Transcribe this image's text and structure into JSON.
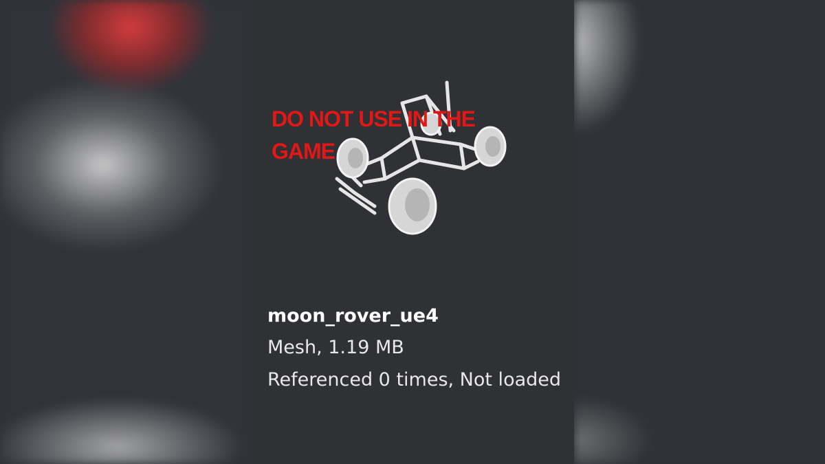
{
  "asset": {
    "name": "moon_rover_ue4",
    "type_size": "Mesh, 1.19 MB",
    "reference_status": "Referenced 0 times, Not loaded",
    "thumbnail_icon": "moon-rover-mesh-thumbnail",
    "watermark": "DO NOT USE IN THE GAME",
    "watermark_color": "#e01818"
  }
}
